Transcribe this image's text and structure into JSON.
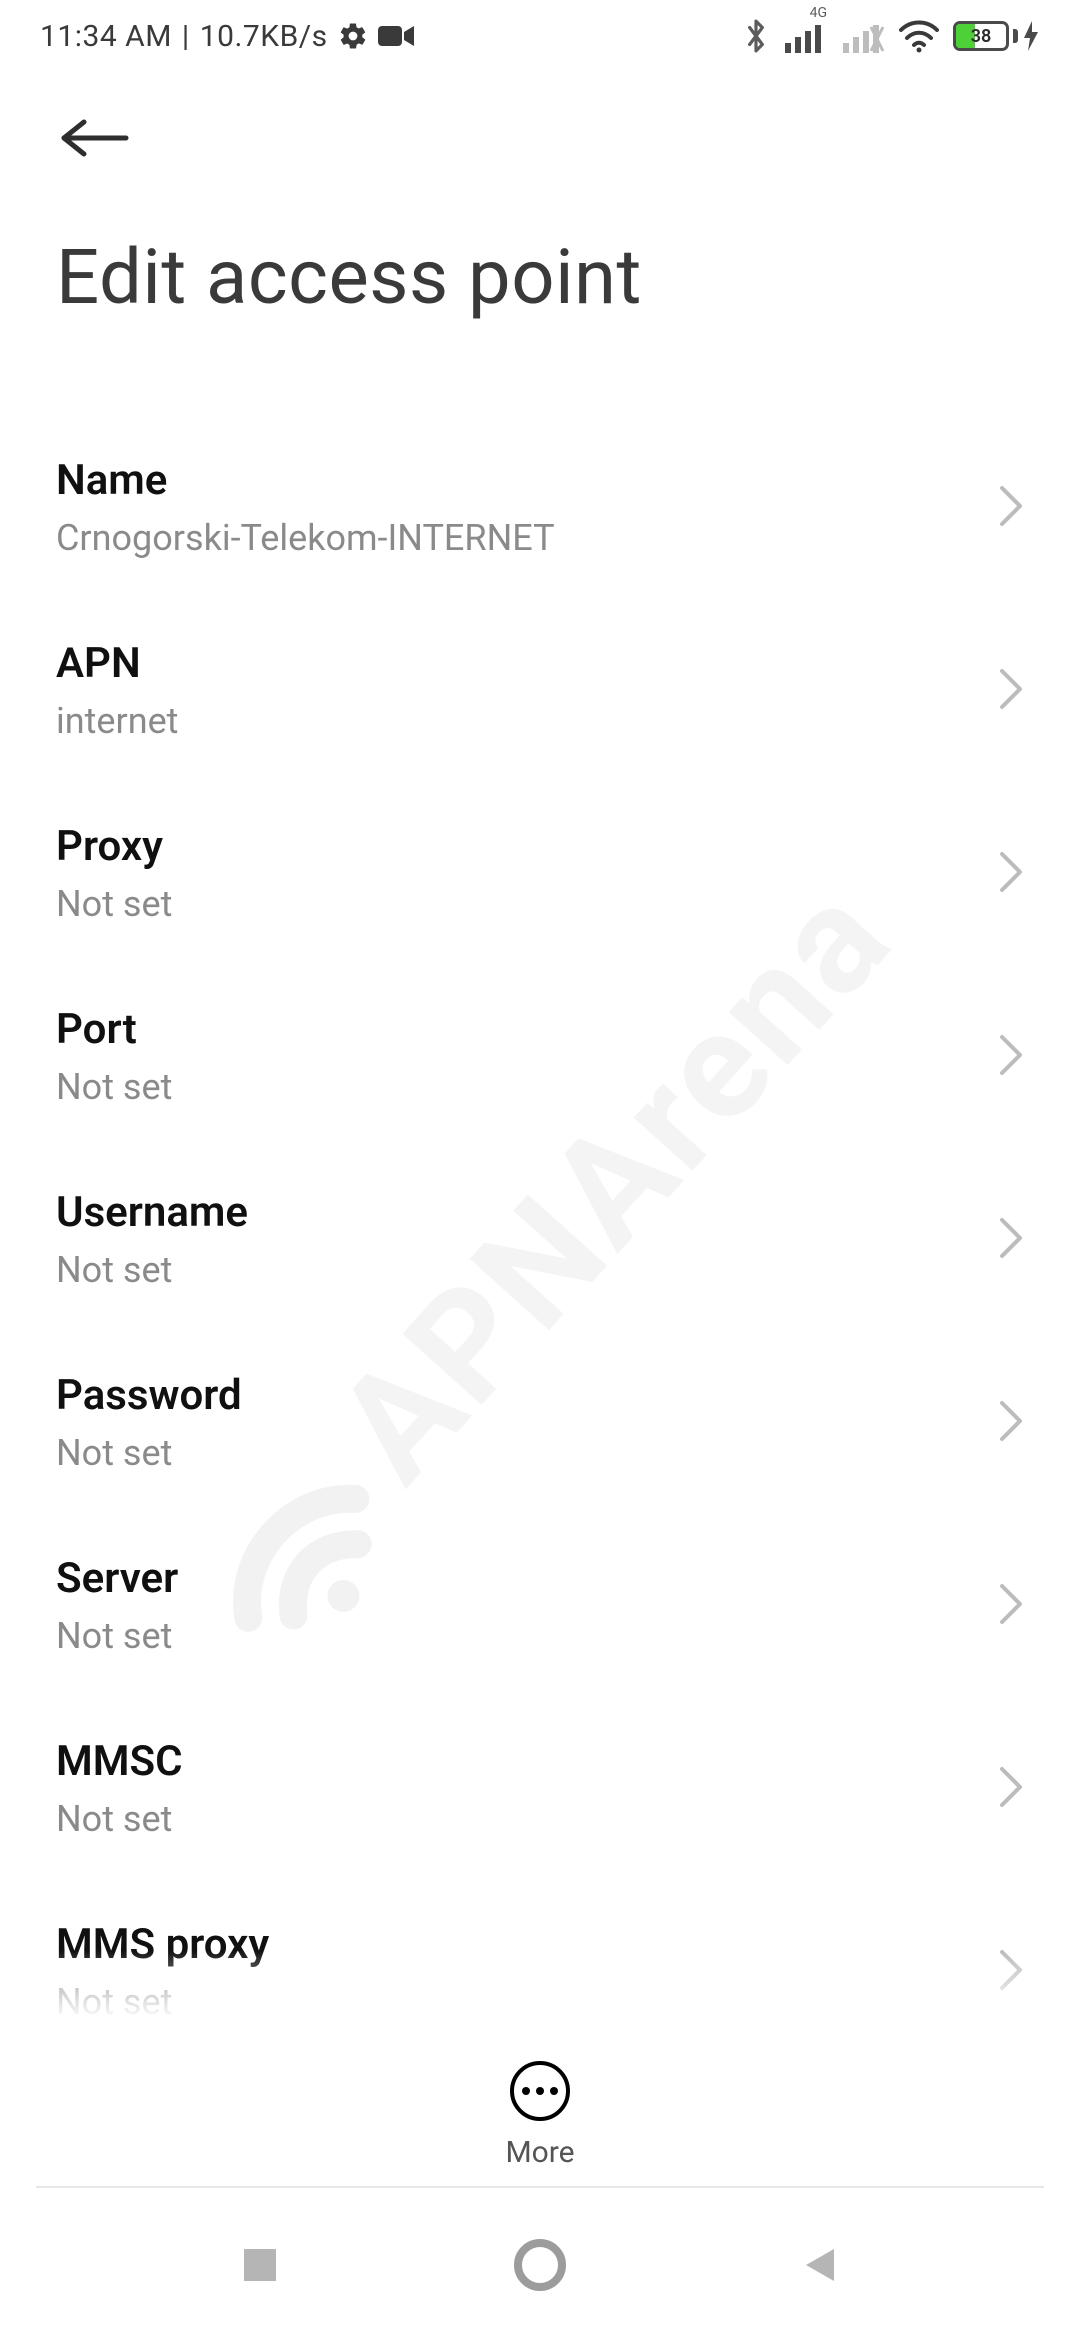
{
  "status": {
    "time": "11:34 AM",
    "sep": "|",
    "speed": "10.7KB/s",
    "signal1_label": "4G",
    "battery_pct": 38,
    "battery_text": "38"
  },
  "header": {
    "title": "Edit access point"
  },
  "rows": [
    {
      "label": "Name",
      "value": "Crnogorski-Telekom-INTERNET"
    },
    {
      "label": "APN",
      "value": "internet"
    },
    {
      "label": "Proxy",
      "value": "Not set"
    },
    {
      "label": "Port",
      "value": "Not set"
    },
    {
      "label": "Username",
      "value": "Not set"
    },
    {
      "label": "Password",
      "value": "Not set"
    },
    {
      "label": "Server",
      "value": "Not set"
    },
    {
      "label": "MMSC",
      "value": "Not set"
    },
    {
      "label": "MMS proxy",
      "value": "Not set"
    }
  ],
  "bottom": {
    "more_label": "More"
  },
  "watermark": {
    "text": "APNArena"
  }
}
